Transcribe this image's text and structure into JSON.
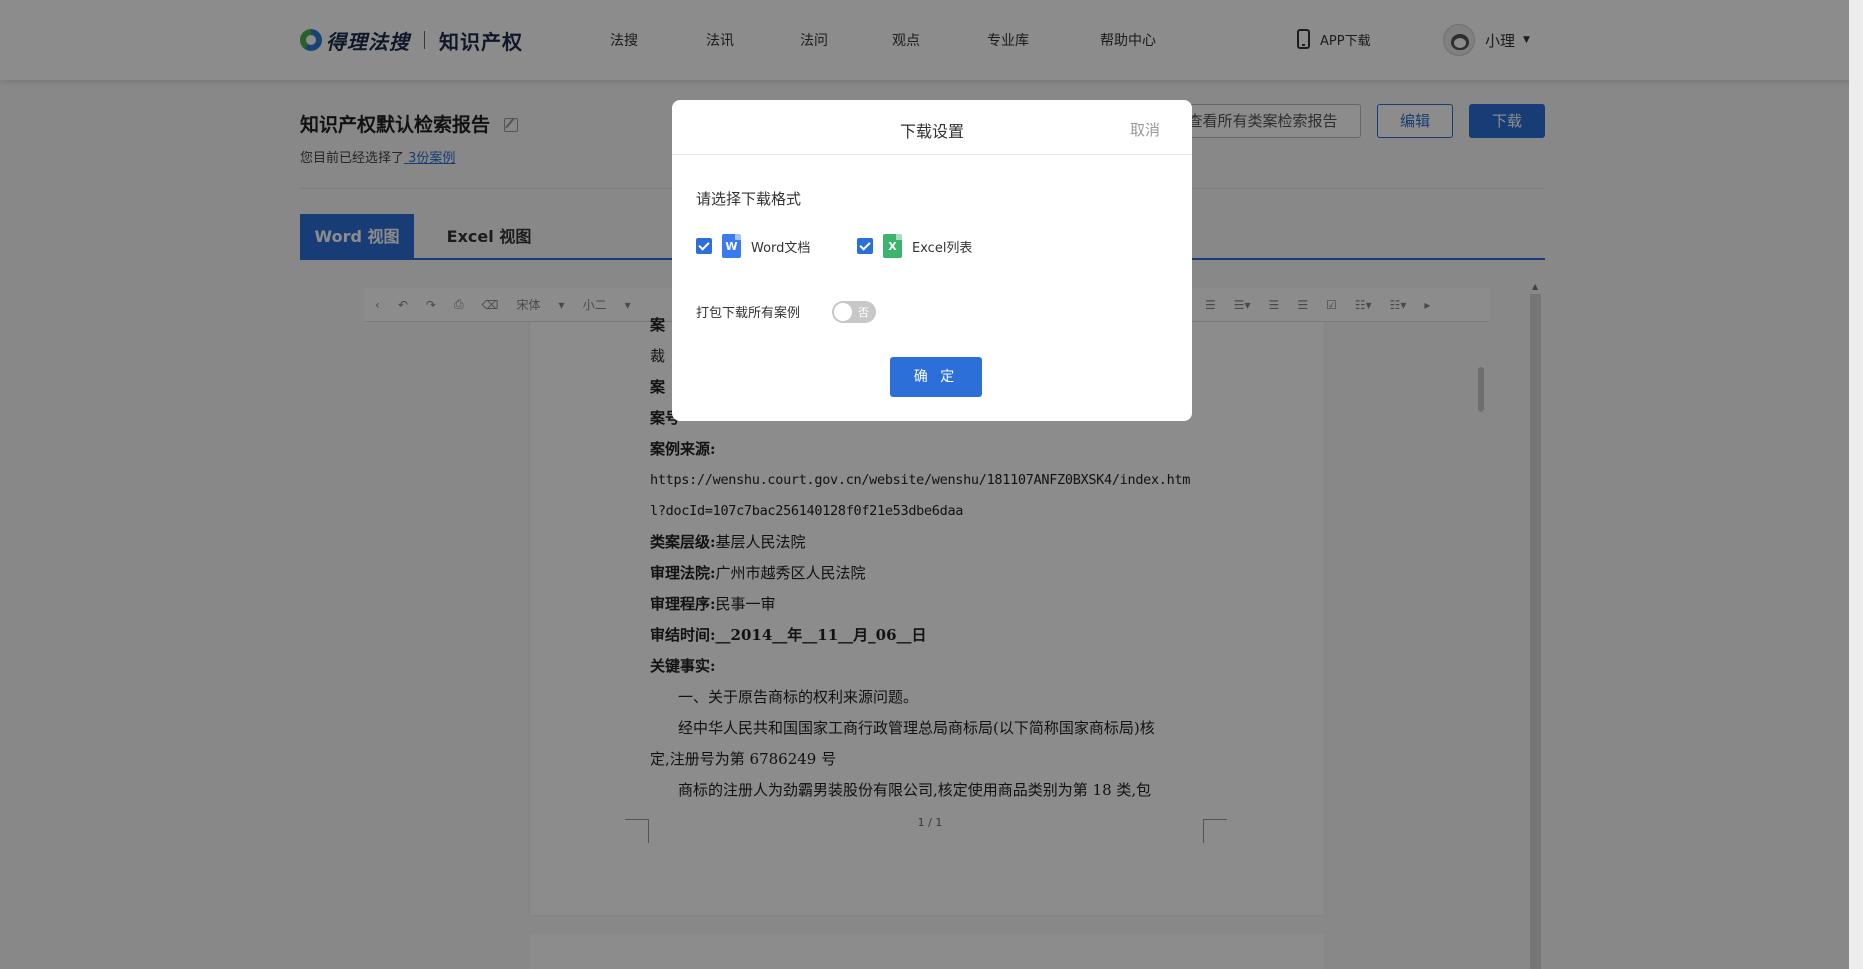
{
  "header": {
    "logo_text": "得理法搜",
    "logo_sub": "知识产权",
    "nav": [
      "法搜",
      "法讯",
      "法问",
      "观点",
      "专业库",
      "帮助中心"
    ],
    "app_download": "APP下载",
    "user_name": "小理"
  },
  "report": {
    "title": "知识产权默认检索报告",
    "selected_prefix": "您目前已经选择了",
    "selected_link": " 3份案例",
    "btn_view_all": "查看所有类案检索报告",
    "btn_edit": "编辑",
    "btn_download": "下载"
  },
  "tabs": {
    "word": "Word 视图",
    "excel": "Excel 视图"
  },
  "toolbar": {
    "font": "宋体",
    "size": "小二"
  },
  "document": {
    "line_1": "案",
    "line_2": "裁",
    "line_3": "案",
    "line_4": "案号",
    "case_source_label": "案例来源:",
    "url_line_1": "https://wenshu.court.gov.cn/website/wenshu/181107ANFZ0BXSK4/index.htm",
    "url_line_2": "l?docId=107c7bac256140128f0f21e53dbe6daa",
    "level_label": "类案层级:",
    "level_value": "基层人民法院",
    "court_label": "审理法院:",
    "court_value": "广州市越秀区人民法院",
    "procedure_label": "审理程序:",
    "procedure_value": "民事一审",
    "date_label": "审结时间:",
    "date_value": "__2014__年__11__月_06__日",
    "facts_label": "关键事实:",
    "fact_1": "一、关于原告商标的权利来源问题。",
    "fact_2": "经中华人民共和国国家工商行政管理总局商标局(以下简称国家商标局)核",
    "fact_3": "定,注册号为第 6786249 号",
    "fact_4": "商标的注册人为劲霸男装股份有限公司,核定使用商品类别为第 18 类,包",
    "page_number": "1 / 1"
  },
  "modal": {
    "title": "下载设置",
    "cancel": "取消",
    "format_label": "请选择下载格式",
    "option_word": "Word文档",
    "option_excel": "Excel列表",
    "word_checked": true,
    "excel_checked": true,
    "pack_label": "打包下载所有案例",
    "toggle_text": "否",
    "toggle_on": false,
    "confirm": "确 定"
  },
  "colors": {
    "accent": "#2d6fd8",
    "word_icon": "#3b7bf0",
    "excel_icon": "#3db46d"
  }
}
